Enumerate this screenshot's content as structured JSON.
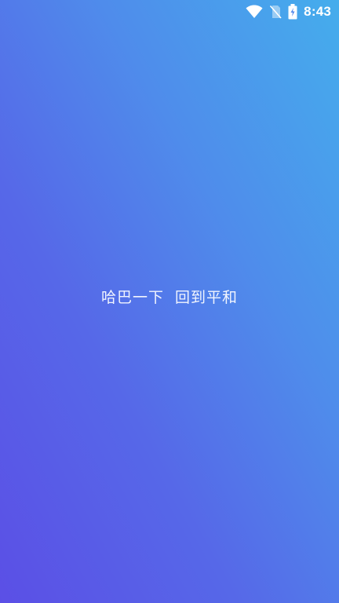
{
  "status_bar": {
    "time": "8:43",
    "icons": [
      "wifi-icon",
      "no-sim-icon",
      "battery-charging-icon"
    ]
  },
  "splash": {
    "slogan": "哈巴一下  回到平和"
  },
  "colors": {
    "gradient_bottom_left": "#5b4fe6",
    "gradient_top_right": "#45adec",
    "text": "#ffffff"
  }
}
